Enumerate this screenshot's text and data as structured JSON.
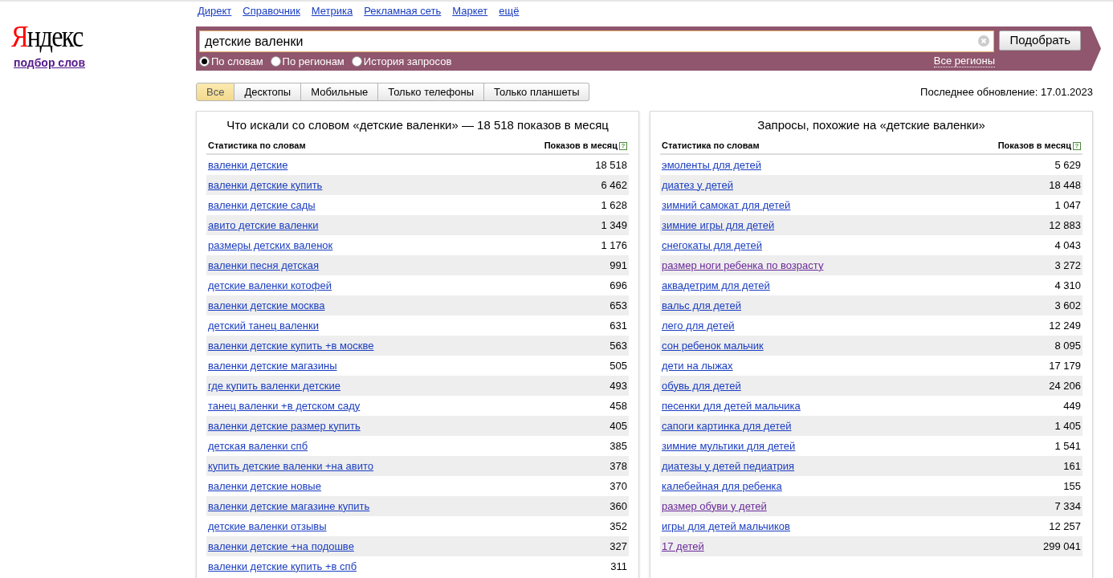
{
  "logo": {
    "text": "Яндекс",
    "subtitle": "подбор слов"
  },
  "top_links": [
    "Директ",
    "Справочник",
    "Метрика",
    "Рекламная сеть",
    "Маркет",
    "ещё"
  ],
  "search": {
    "value": "детские валенки",
    "button": "Подобрать",
    "region_link": "Все регионы",
    "modes": [
      {
        "label": "По словам",
        "selected": true
      },
      {
        "label": "По регионам",
        "selected": false
      },
      {
        "label": "История запросов",
        "selected": false
      }
    ]
  },
  "device_tabs": [
    {
      "label": "Все",
      "selected": true
    },
    {
      "label": "Десктопы",
      "selected": false
    },
    {
      "label": "Мобильные",
      "selected": false
    },
    {
      "label": "Только телефоны",
      "selected": false
    },
    {
      "label": "Только планшеты",
      "selected": false
    }
  ],
  "last_update": "Последнее обновление: 17.01.2023",
  "panels": [
    {
      "title": "Что искали со словом «детские валенки» — 18 518 показов в месяц",
      "columns": [
        "Статистика по словам",
        "Показов в месяц"
      ],
      "help": "?",
      "rows": [
        {
          "phrase": "валенки детские",
          "count": "18 518",
          "visited": false
        },
        {
          "phrase": "валенки детские купить",
          "count": "6 462",
          "visited": false
        },
        {
          "phrase": "валенки детские сады",
          "count": "1 628",
          "visited": false
        },
        {
          "phrase": "авито детские валенки",
          "count": "1 349",
          "visited": false
        },
        {
          "phrase": "размеры детских валенок",
          "count": "1 176",
          "visited": false
        },
        {
          "phrase": "валенки песня детская",
          "count": "991",
          "visited": false
        },
        {
          "phrase": "детские валенки котофей",
          "count": "696",
          "visited": false
        },
        {
          "phrase": "валенки детские москва",
          "count": "653",
          "visited": false
        },
        {
          "phrase": "детский танец валенки",
          "count": "631",
          "visited": false
        },
        {
          "phrase": "валенки детские купить +в москве",
          "count": "563",
          "visited": false
        },
        {
          "phrase": "валенки детские магазины",
          "count": "505",
          "visited": false
        },
        {
          "phrase": "где купить валенки детские",
          "count": "493",
          "visited": false
        },
        {
          "phrase": "танец валенки +в детском саду",
          "count": "458",
          "visited": false
        },
        {
          "phrase": "валенки детские размер купить",
          "count": "405",
          "visited": false
        },
        {
          "phrase": "детская валенки спб",
          "count": "385",
          "visited": false
        },
        {
          "phrase": "купить детские валенки +на авито",
          "count": "378",
          "visited": false
        },
        {
          "phrase": "валенки детские новые",
          "count": "370",
          "visited": false
        },
        {
          "phrase": "валенки детские магазине купить",
          "count": "360",
          "visited": false
        },
        {
          "phrase": "детские валенки отзывы",
          "count": "352",
          "visited": false
        },
        {
          "phrase": "валенки детские +на подошве",
          "count": "327",
          "visited": false
        },
        {
          "phrase": "валенки детские купить +в спб",
          "count": "311",
          "visited": false
        }
      ]
    },
    {
      "title": "Запросы, похожие на «детские валенки»",
      "columns": [
        "Статистика по словам",
        "Показов в месяц"
      ],
      "help": "?",
      "rows": [
        {
          "phrase": "эмоленты для детей",
          "count": "5 629",
          "visited": false
        },
        {
          "phrase": "диатез у детей",
          "count": "18 448",
          "visited": false
        },
        {
          "phrase": "зимний самокат для детей",
          "count": "1 047",
          "visited": false
        },
        {
          "phrase": "зимние игры для детей",
          "count": "12 883",
          "visited": false
        },
        {
          "phrase": "снегокаты для детей",
          "count": "4 043",
          "visited": false
        },
        {
          "phrase": "размер ноги ребенка по возрасту",
          "count": "3 272",
          "visited": true
        },
        {
          "phrase": "аквадетрим для детей",
          "count": "4 310",
          "visited": false
        },
        {
          "phrase": "вальс для детей",
          "count": "3 602",
          "visited": false
        },
        {
          "phrase": "лего для детей",
          "count": "12 249",
          "visited": false
        },
        {
          "phrase": "сон ребенок мальчик",
          "count": "8 095",
          "visited": false
        },
        {
          "phrase": "дети на лыжах",
          "count": "17 179",
          "visited": false
        },
        {
          "phrase": "обувь для детей",
          "count": "24 206",
          "visited": false
        },
        {
          "phrase": "песенки для детей мальчика",
          "count": "449",
          "visited": false
        },
        {
          "phrase": "сапоги картинка для детей",
          "count": "1 405",
          "visited": false
        },
        {
          "phrase": "зимние мультики для детей",
          "count": "1 541",
          "visited": false
        },
        {
          "phrase": "диатезы у детей педиатрия",
          "count": "161",
          "visited": false
        },
        {
          "phrase": "калебейная для ребенка",
          "count": "155",
          "visited": false
        },
        {
          "phrase": "размер обуви у детей",
          "count": "7 334",
          "visited": true
        },
        {
          "phrase": "игры для детей мальчиков",
          "count": "12 257",
          "visited": false
        },
        {
          "phrase": "17 детей",
          "count": "299 041",
          "visited": true
        }
      ]
    }
  ]
}
